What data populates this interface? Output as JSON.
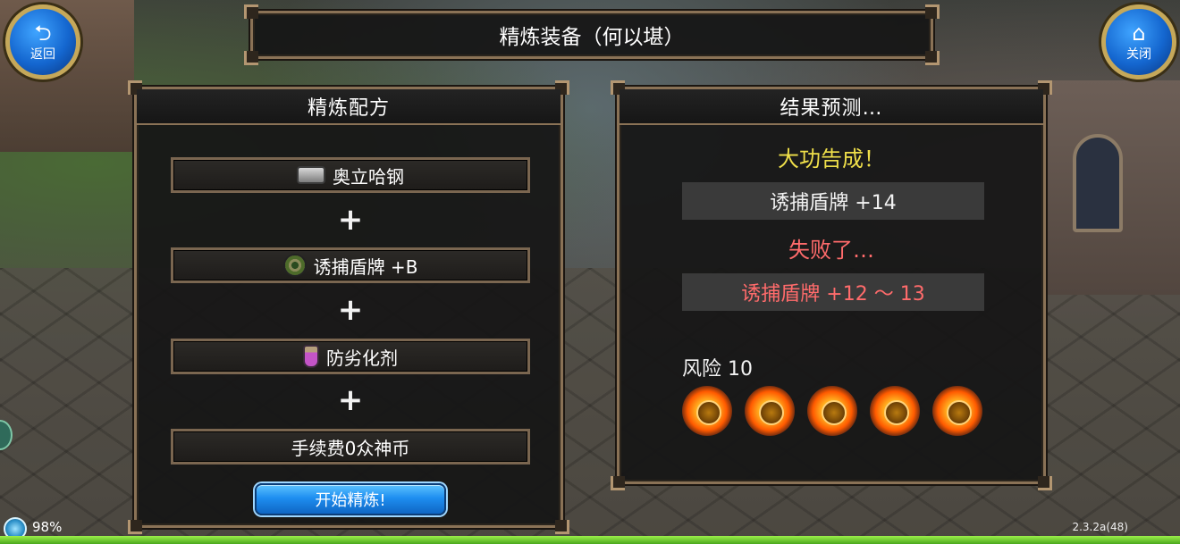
{
  "title": "精炼装备（何以堪）",
  "buttons": {
    "back_label": "返回",
    "close_label": "关闭",
    "start_label": "开始精炼!"
  },
  "recipe": {
    "header": "精炼配方",
    "material": "奥立哈钢",
    "equipment": "诱捕盾牌 +B",
    "protectant": "防劣化剂",
    "fee": "手续费0众神币",
    "icons": [
      "ingot-icon",
      "shield-icon",
      "potion-icon"
    ]
  },
  "result": {
    "header": "结果预测…",
    "success_label": "大功告成！",
    "success_item": "诱捕盾牌 +14",
    "fail_label": "失败了…",
    "fail_item": "诱捕盾牌 +12 ～ 13",
    "risk_label": "风险 10",
    "risk_icon_count": 5
  },
  "status": {
    "battery": "98%",
    "version": "2.3.2a(48)",
    "progress_fraction": 1.0
  },
  "colors": {
    "success": "#f0e04a",
    "fail": "#ff6b6b",
    "frame_border": "#8a7256",
    "accent_blue": "#1e8ef0"
  }
}
